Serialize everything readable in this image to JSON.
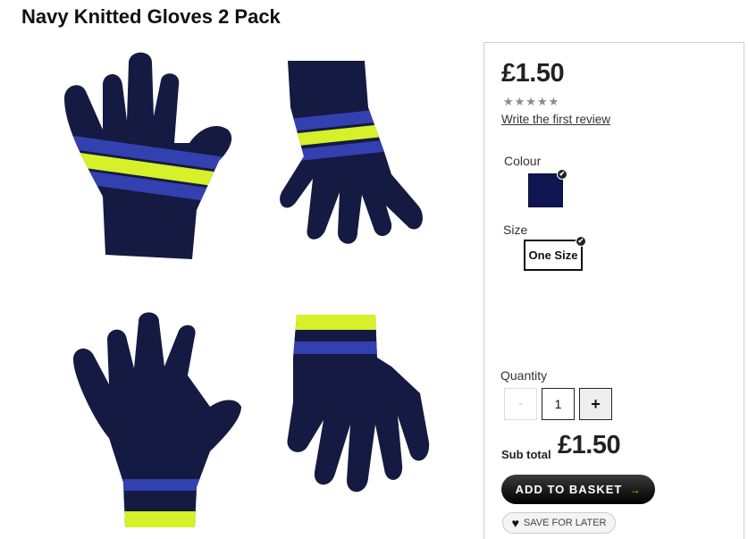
{
  "product": {
    "title": "Navy Knitted Gloves 2 Pack",
    "price": "£1.50",
    "rating": {
      "stars": "★★★★★",
      "stars_filled": 0,
      "stars_total": 5
    },
    "review_link": "Write the first review",
    "colour_label": "Colour",
    "selected_colour": "#0f1550",
    "size_label": "Size",
    "selected_size": "One Size",
    "quantity_label": "Quantity",
    "quantity": "1",
    "minus_label": "-",
    "plus_label": "+",
    "subtotal_label": "Sub total",
    "subtotal_value": "£1.50",
    "add_to_basket": "ADD TO BASKET",
    "save_for_later": "SAVE FOR LATER"
  },
  "icons": {
    "check": "✔",
    "arrow": "→",
    "heart": "♥"
  }
}
